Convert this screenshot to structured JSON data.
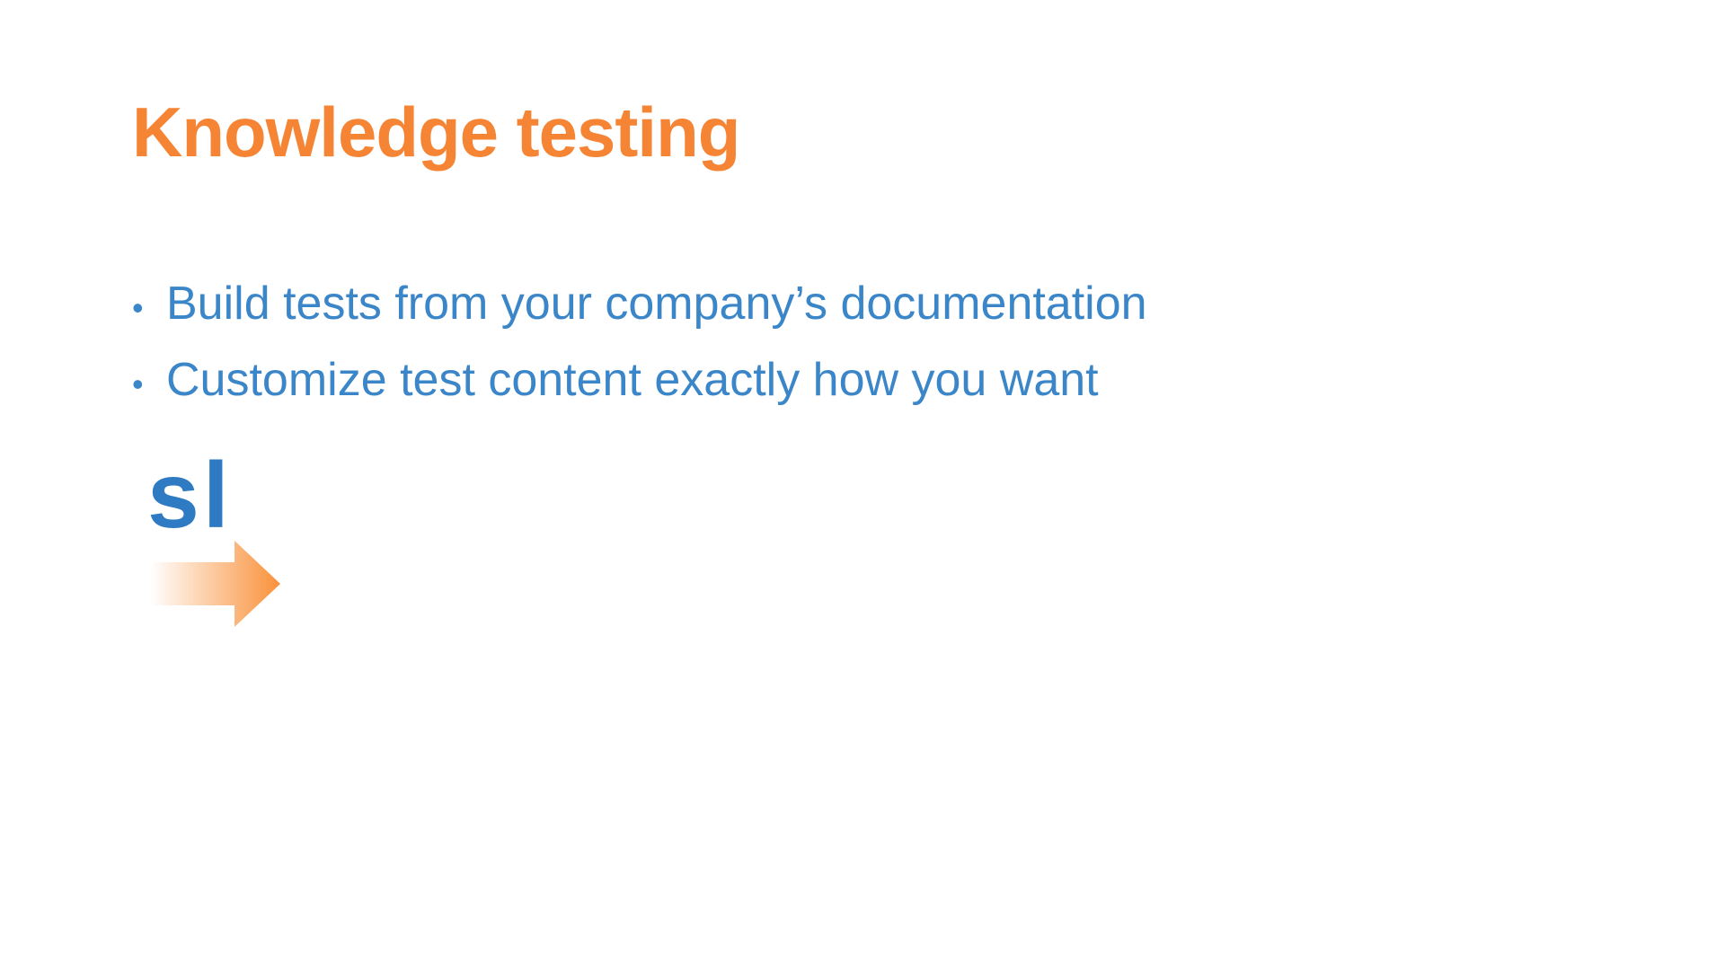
{
  "slide": {
    "title": "Knowledge testing",
    "bullets": [
      "Build tests from your company’s documentation",
      "Customize test content exactly how you want"
    ],
    "bullet_glyph": "•",
    "logo_text": "sl"
  },
  "colors": {
    "title": "#F58434",
    "body": "#3A86C8",
    "logo_text": "#2E7BC4",
    "arrow_start": "#FFFFFF",
    "arrow_end": "#F9913A"
  },
  "icons": {
    "logo_arrow": "right-arrow-icon"
  }
}
